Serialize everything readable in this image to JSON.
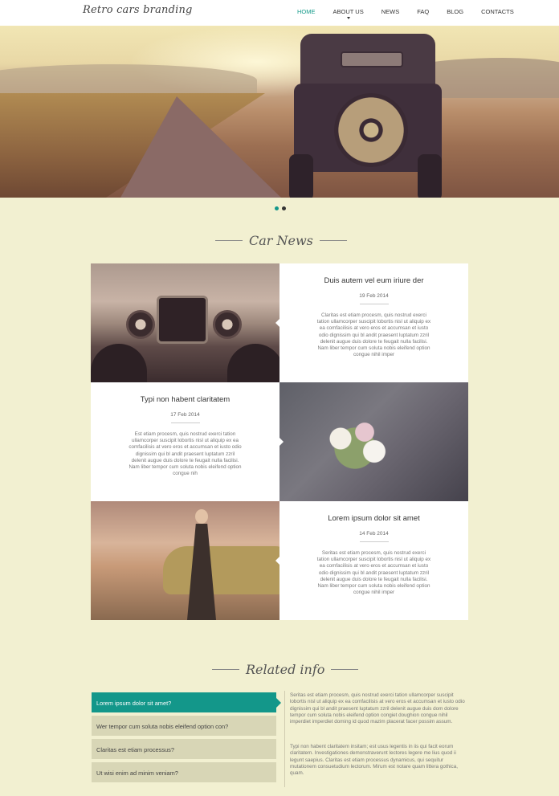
{
  "header": {
    "logo": "Retro cars branding",
    "nav": [
      {
        "label": "HOME",
        "active": true
      },
      {
        "label": "ABOUT US",
        "active": false,
        "has_dropdown": true
      },
      {
        "label": "NEWS",
        "active": false
      },
      {
        "label": "FAQ",
        "active": false
      },
      {
        "label": "BLOG",
        "active": false
      },
      {
        "label": "CONTACTS",
        "active": false
      }
    ]
  },
  "slider": {
    "dots": [
      {
        "active": true
      },
      {
        "active": false
      }
    ]
  },
  "news": {
    "title": "Car News",
    "items": [
      {
        "title": "Duis autem vel eum iriure der",
        "date": "19 Feb 2014",
        "text": "Claritas est etiam procesm, quis nostrud exerci tation ullamcorper suscipit lobortis nisl ut aliquip ex ea comfacilisis at vero eros et accumsan et iusto odio dignissim qui bl andit praesent luptatum zzril delenit augue duis dolore te feugait nulla facilisi. Nam liber tempor cum soluta nobis eleifend option congue nihil imper"
      },
      {
        "title": "Typi non habent claritatem",
        "date": "17 Feb 2014",
        "text": "Est etiam procesm, quis nostrud exerci tation ullamcorper suscipit lobortis nisl ut aliquip ex ea comfacilisis at vero eros et accumsan et iusto odio dignissim qui bl andit praesent luptatum zzril delenit augue duis dolore te feugait nulla facilisi. Nam liber tempor cum soluta nobis eleifend option congue nih"
      },
      {
        "title": "Lorem ipsum dolor sit amet",
        "date": "14 Feb 2014",
        "text": "Seritas est etiam procesm, quis nostrud exerci tation ullamcorper suscipit lobortis nisl ut aliquip ex ea comfacilisis at vero eros et accumsan et iusto odio dignissim qui bl andit praesent luptatum zzril delenit augue duis dolore te feugait nulla facilisi. Nam liber tempor cum soluta nobis eleifend option congue nihil imper"
      }
    ]
  },
  "related": {
    "title": "Related info",
    "tabs": [
      {
        "label": "Lorem ipsum dolor sit amet?",
        "active": true
      },
      {
        "label": "Wer tempor cum soluta nobis eleifend option con?",
        "active": false
      },
      {
        "label": "Claritas est etiam processus?",
        "active": false
      },
      {
        "label": "Ut wisi enim ad minim veniam?",
        "active": false
      }
    ],
    "paragraphs": [
      "Seritas est etiam procesm, quis nostrud exerci tation ullamcorper suscipit lobortis nisl ut aliquip ex ea comfacilisis at vero eros et accumsan et iusto odio dignissim qui bl andit praesent luptatum zzril delenit augue duis dom dolore tempor cum soluta nobis eleifend option congiet doughion congue nihil imperdiet imperdiet doming id quod mazim placerat facer possim assum.",
      "Typi non habent claritatem insitam; est usus legentis in iis qui facit eorum claritatem. Investigationes demonstraverunt lectores legere me lius quod ii legunt saepius. Claritas est etiam processus dynamicus, qui sequitur mutationem consuetudium lectorum. Mirum est notare quam littera gothica, quam."
    ]
  },
  "colors": {
    "accent": "#13978a",
    "page_bg": "#f2f0d1",
    "tab_bg": "#d8d6b6",
    "dot_inactive": "#333333"
  }
}
